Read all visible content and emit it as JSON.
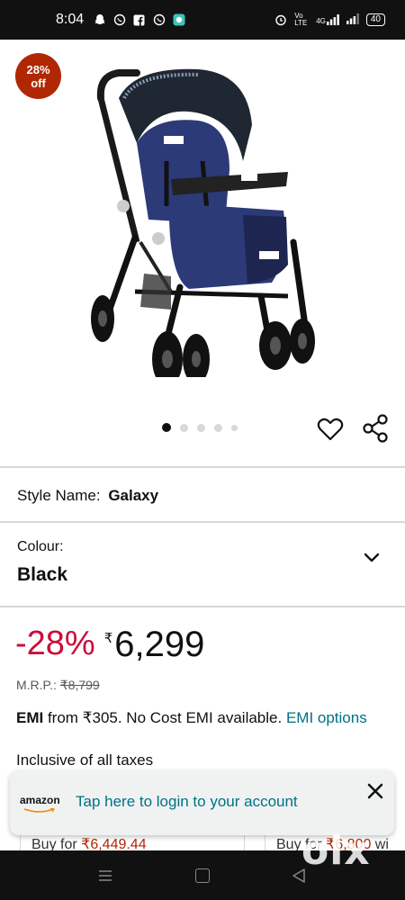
{
  "status_bar": {
    "time": "8:04",
    "left_icons": [
      "snapchat-icon",
      "whatsapp-icon",
      "facebook-icon",
      "whatsapp-icon",
      "chat-app-icon"
    ],
    "right_icons": [
      "alarm-icon",
      "volte-icon",
      "signal-4g-icon",
      "signal-icon"
    ],
    "volte_text": "Vo LTE",
    "network_text": "4G",
    "battery": "40"
  },
  "product": {
    "discount_badge_line1": "28%",
    "discount_badge_line2": "off",
    "image_alt_icon": "stroller-product-image",
    "carousel_dots": 5,
    "carousel_active_index": 0
  },
  "style": {
    "label": "Style Name:",
    "value": "Galaxy"
  },
  "colour": {
    "label": "Colour:",
    "value": "Black"
  },
  "price": {
    "discount_pct": "-28%",
    "currency": "₹",
    "amount": "6,299",
    "mrp_label": "M.R.P.:",
    "mrp_value": "₹8,799"
  },
  "emi": {
    "bold": "EMI",
    "text": " from ₹305. No Cost EMI available. ",
    "link": "EMI options"
  },
  "taxes": "Inclusive of all taxes",
  "toast": {
    "logo_text": "amazon",
    "message": "Tap here to login to your account"
  },
  "offers_peek": {
    "left_prefix": "Buy for ",
    "left_price": "₹6,449.44",
    "right_prefix": "Buy for ",
    "right_price": "₹6,800",
    "right_suffix": " wi"
  },
  "watermark": "olx",
  "colors": {
    "accent_red": "#cc0c39",
    "badge_red": "#b12704",
    "link_teal": "#007185"
  }
}
